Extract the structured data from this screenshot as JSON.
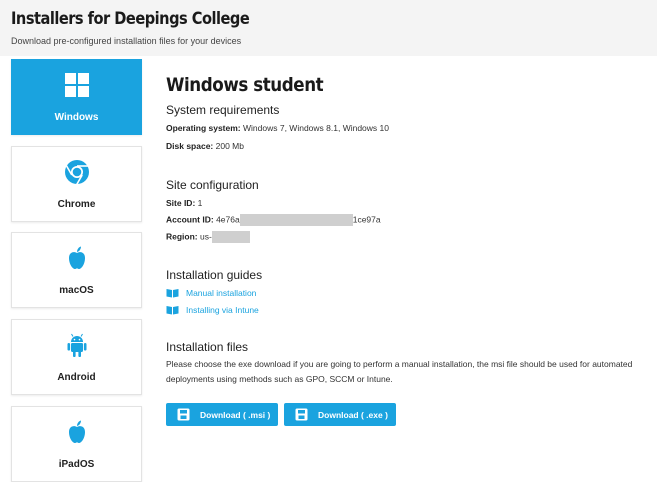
{
  "header": {
    "title": "Installers for Deepings College",
    "subtitle": "Download pre-configured installation files for your devices"
  },
  "sidebar": {
    "items": [
      {
        "label": "Windows",
        "icon": "windows-icon",
        "active": true
      },
      {
        "label": "Chrome",
        "icon": "chrome-icon",
        "active": false
      },
      {
        "label": "macOS",
        "icon": "apple-icon",
        "active": false
      },
      {
        "label": "Android",
        "icon": "android-icon",
        "active": false
      },
      {
        "label": "iPadOS",
        "icon": "apple-icon",
        "active": false
      }
    ]
  },
  "main": {
    "title": "Windows student",
    "requirements": {
      "heading": "System requirements",
      "os_label": "Operating system:",
      "os_value": "Windows 7, Windows 8.1, Windows 10",
      "disk_label": "Disk space:",
      "disk_value": "200 Mb"
    },
    "site_config": {
      "heading": "Site configuration",
      "site_id_label": "Site ID:",
      "site_id_value": "1",
      "account_label": "Account ID:",
      "account_prefix": "4e76a",
      "account_suffix": "1ce97a",
      "region_label": "Region:",
      "region_prefix": "us-"
    },
    "guides": {
      "heading": "Installation guides",
      "links": [
        "Manual installation",
        "Installing via Intune"
      ]
    },
    "files": {
      "heading": "Installation files",
      "description": "Please choose the exe download if you are going to perform a manual installation, the msi file should be used for automated deployments using methods such as GPO, SCCM or Intune.",
      "msi_label": "Download ( .msi )",
      "exe_label": "Download ( .exe )"
    }
  },
  "colors": {
    "accent": "#1aa3df",
    "header_bg": "#f4f4f4",
    "redaction": "#cfcfcf",
    "android_green": "#1aa3df"
  }
}
